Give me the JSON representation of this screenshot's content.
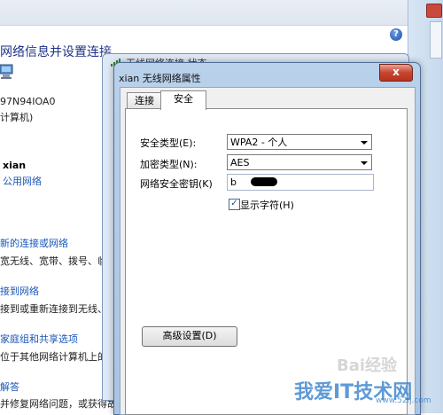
{
  "background": {
    "title": "网络信息并设置连接",
    "computer_name": "97N94IOA0",
    "computer_sub": "计算机)",
    "network_name": "xian",
    "network_type": "公用网络",
    "link1_title": "新的连接或网络",
    "link1_desc": "宽无线、宽带、拨号、临时",
    "link2_title": "接到网络",
    "link2_desc": "接到或重新连接到无线、有",
    "link3_title": "家庭组和共享选项",
    "link3_desc": "位于其他网络计算机上的",
    "link4_title": "解答",
    "link4_desc": "并修复网络问题，或获得故"
  },
  "status_window": {
    "title": "无线网络连接 状态"
  },
  "dialog": {
    "title": "xian 无线网络属性",
    "close_label": "x",
    "tabs": [
      {
        "label": "连接",
        "selected": false
      },
      {
        "label": "安全",
        "selected": true
      }
    ],
    "security_type_label": "安全类型(E):",
    "security_type_value": "WPA2 - 个人",
    "encryption_type_label": "加密类型(N):",
    "encryption_type_value": "AES",
    "key_label": "网络安全密钥(K)",
    "key_value": "b",
    "show_chars_label": "显示字符(H)",
    "show_chars_checked": true,
    "advanced_button": "高级设置(D)"
  },
  "watermark": {
    "baidu": "Bai经验",
    "main": "我爱IT技术网",
    "url": "www.52ij.com"
  },
  "colors": {
    "link": "#1a57b8",
    "title": "#1e3287"
  }
}
